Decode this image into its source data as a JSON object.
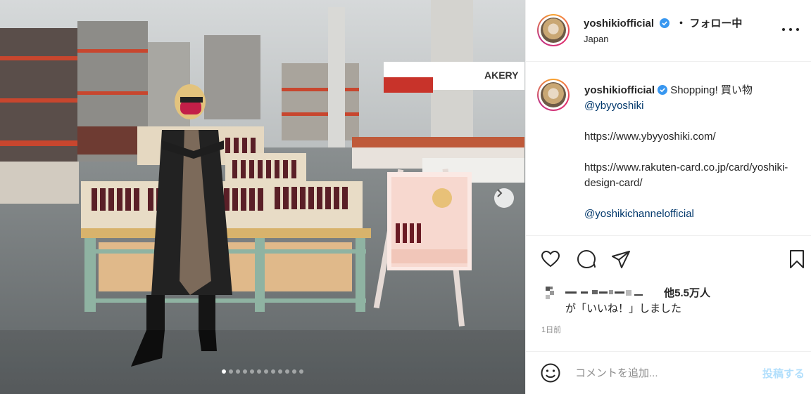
{
  "post": {
    "carousel_count": 12,
    "carousel_active_index": 0
  },
  "header": {
    "username": "yoshikiofficial",
    "separator": "・",
    "follow_status": "フォロー中",
    "location": "Japan"
  },
  "caption": {
    "username": "yoshikiofficial",
    "text": "Shopping! 買い物",
    "mention1": "@ybyyoshiki",
    "url1": "https://www.ybyyoshiki.com/",
    "url2": "https://www.rakuten-card.co.jp/card/yoshiki-design-card/",
    "mention2": "@yoshikichannelofficial"
  },
  "likes": {
    "others": "他5.5万人",
    "line2": "が「いいね！」しました"
  },
  "timestamp": "1日前",
  "comment": {
    "placeholder": "コメントを追加...",
    "post_label": "投稿する"
  },
  "icons": [
    "heart-icon",
    "comment-icon",
    "share-icon",
    "bookmark-icon",
    "more-icon",
    "emoji-icon",
    "chevron-right-icon",
    "verified-badge-icon"
  ],
  "colors": {
    "link": "#00376b",
    "verified": "#3897f0",
    "post_button_disabled": "#b2dffc",
    "muted": "#8e8e8e"
  }
}
